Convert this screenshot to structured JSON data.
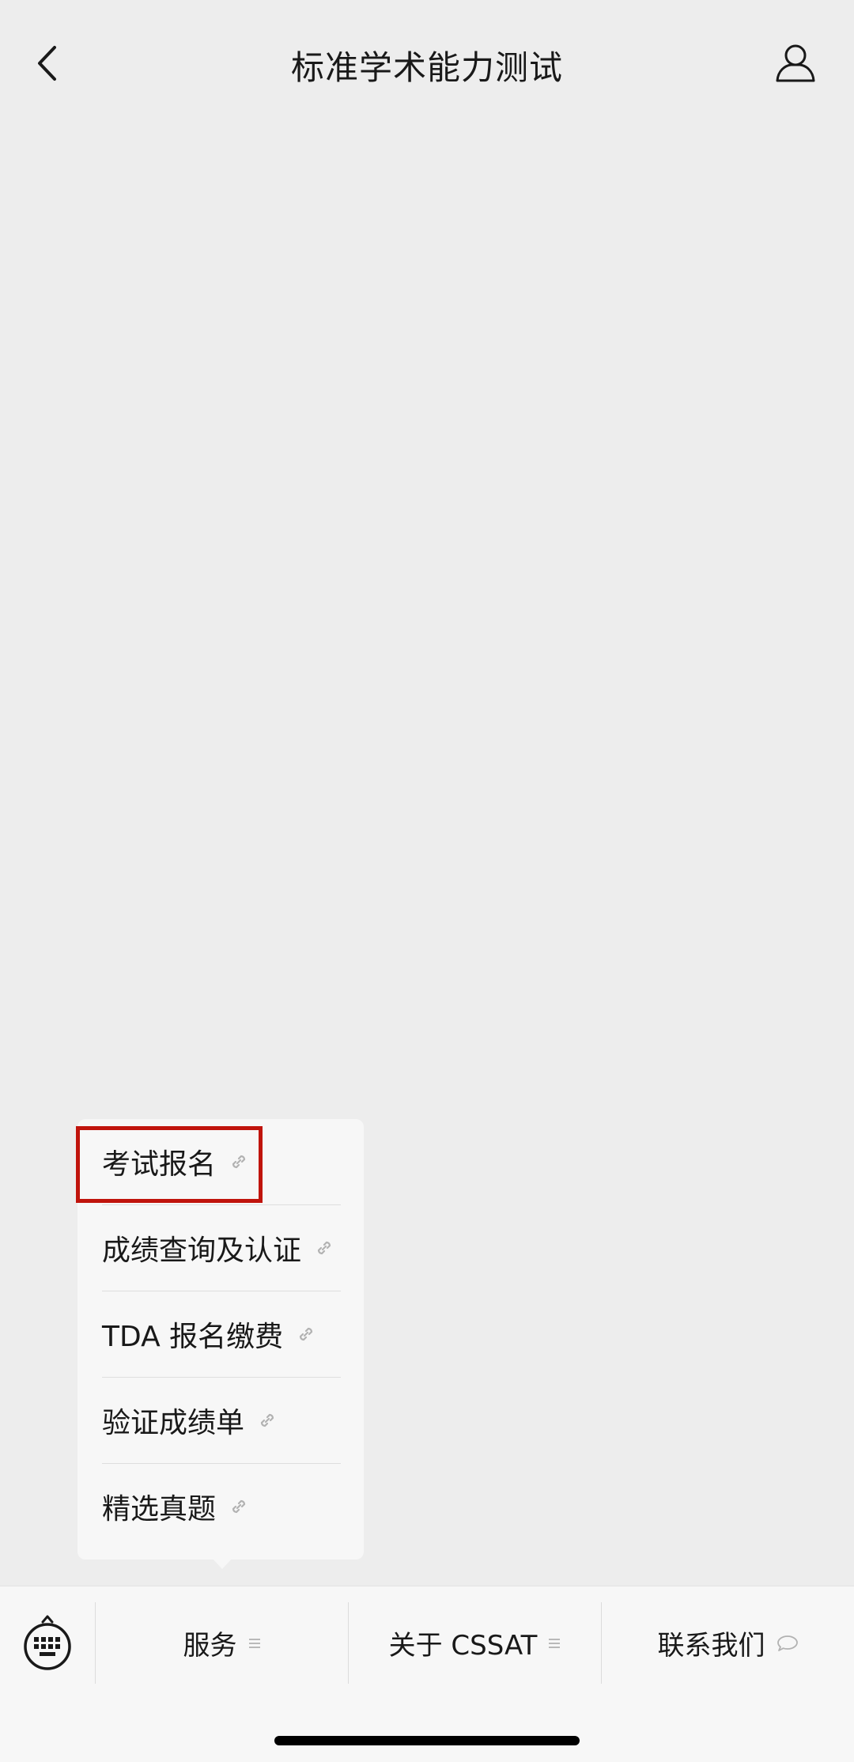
{
  "header": {
    "title": "标准学术能力测试",
    "back_icon": "chevron-left-icon",
    "profile_icon": "person-icon"
  },
  "popup_menu": {
    "items": [
      {
        "label": "考试报名",
        "icon": "link-icon"
      },
      {
        "label": "成绩查询及认证",
        "icon": "link-icon"
      },
      {
        "label": "TDA 报名缴费",
        "icon": "link-icon"
      },
      {
        "label": "验证成绩单",
        "icon": "link-icon"
      },
      {
        "label": "精选真题",
        "icon": "link-icon"
      }
    ],
    "highlighted_item": "考试报名",
    "highlight_color": "#c0140c"
  },
  "bottom_menu": {
    "keyboard_icon": "keyboard-icon",
    "tabs": [
      {
        "label": "服务",
        "icon": "menu-lines-icon"
      },
      {
        "label": "关于 CSSAT",
        "icon": "menu-lines-icon"
      },
      {
        "label": "联系我们",
        "icon": "speech-bubble-icon"
      }
    ]
  },
  "colors": {
    "background": "#ededed",
    "panel": "#f7f7f7",
    "text": "#191919"
  }
}
